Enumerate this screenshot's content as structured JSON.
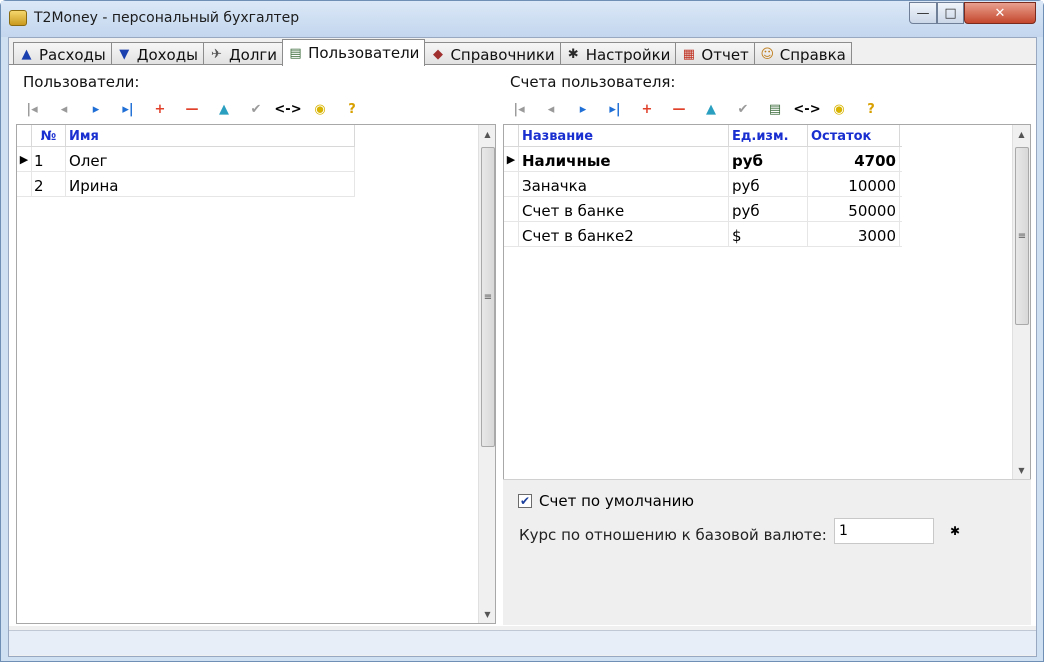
{
  "window": {
    "title": "T2Money - персональный бухгалтер"
  },
  "tabs": [
    {
      "label": "Расходы",
      "icon": "expense-arrow-icon",
      "glyph": "▲",
      "color": "#1a3fae"
    },
    {
      "label": "Доходы",
      "icon": "income-arrow-icon",
      "glyph": "▼",
      "color": "#1a3fae"
    },
    {
      "label": "Долги",
      "icon": "debts-icon",
      "glyph": "✈",
      "color": "#555555"
    },
    {
      "label": "Пользователи",
      "icon": "users-icon",
      "glyph": "▤",
      "color": "#3a6a3a",
      "active": true
    },
    {
      "label": "Справочники",
      "icon": "reference-books-icon",
      "glyph": "◆",
      "color": "#a03030"
    },
    {
      "label": "Настройки",
      "icon": "settings-icon",
      "glyph": "✱",
      "color": "#2a2a2a"
    },
    {
      "label": "Отчет",
      "icon": "report-icon",
      "glyph": "▦",
      "color": "#c03020"
    },
    {
      "label": "Справка",
      "icon": "help-icon",
      "glyph": "☺",
      "color": "#c08020"
    }
  ],
  "users_panel": {
    "label": "Пользователи:",
    "columns": [
      "№",
      "Имя"
    ],
    "rows": [
      {
        "num": "1",
        "name": "Олег",
        "current": true
      },
      {
        "num": "2",
        "name": "Ирина",
        "current": false
      }
    ]
  },
  "accounts_panel": {
    "label": "Счета пользователя:",
    "columns": [
      "Название",
      "Ед.изм.",
      "Остаток"
    ],
    "rows": [
      {
        "name": "Наличные",
        "unit": "руб",
        "balance": "4700",
        "current": true
      },
      {
        "name": "Заначка",
        "unit": "руб",
        "balance": "10000",
        "current": false
      },
      {
        "name": "Счет в банке",
        "unit": "руб",
        "balance": "50000",
        "current": false
      },
      {
        "name": "Счет в банке2",
        "unit": "$",
        "balance": "3000",
        "current": false
      }
    ],
    "default_account": {
      "label": "Счет по умолчанию",
      "checked": true
    },
    "rate": {
      "label": "Курс по отношению к базовой валюте:",
      "value": "1"
    }
  },
  "toolbar_icons": {
    "first": {
      "glyph": "|◂",
      "color": "#9a9a9a"
    },
    "prev": {
      "glyph": "◂",
      "color": "#9a9a9a"
    },
    "next": {
      "glyph": "▸",
      "color": "#1f6fd6"
    },
    "last": {
      "glyph": "▸|",
      "color": "#1f6fd6"
    },
    "add": {
      "glyph": "+",
      "color": "#e0402a"
    },
    "delete": {
      "glyph": "—",
      "color": "#e0402a"
    },
    "edit": {
      "glyph": "▲",
      "color": "#2a9fbf"
    },
    "confirm": {
      "glyph": "✔",
      "color": "#9a9a9a"
    },
    "copy": {
      "glyph": "▤",
      "color": "#3a6a3a"
    },
    "swap": {
      "glyph": "<->",
      "color": "#000000"
    },
    "find": {
      "glyph": "◉",
      "color": "#d8b400"
    },
    "help": {
      "glyph": "?",
      "color": "#d8a000"
    }
  },
  "window_controls": {
    "minimize": "—",
    "maximize": "□",
    "close": "✕"
  }
}
